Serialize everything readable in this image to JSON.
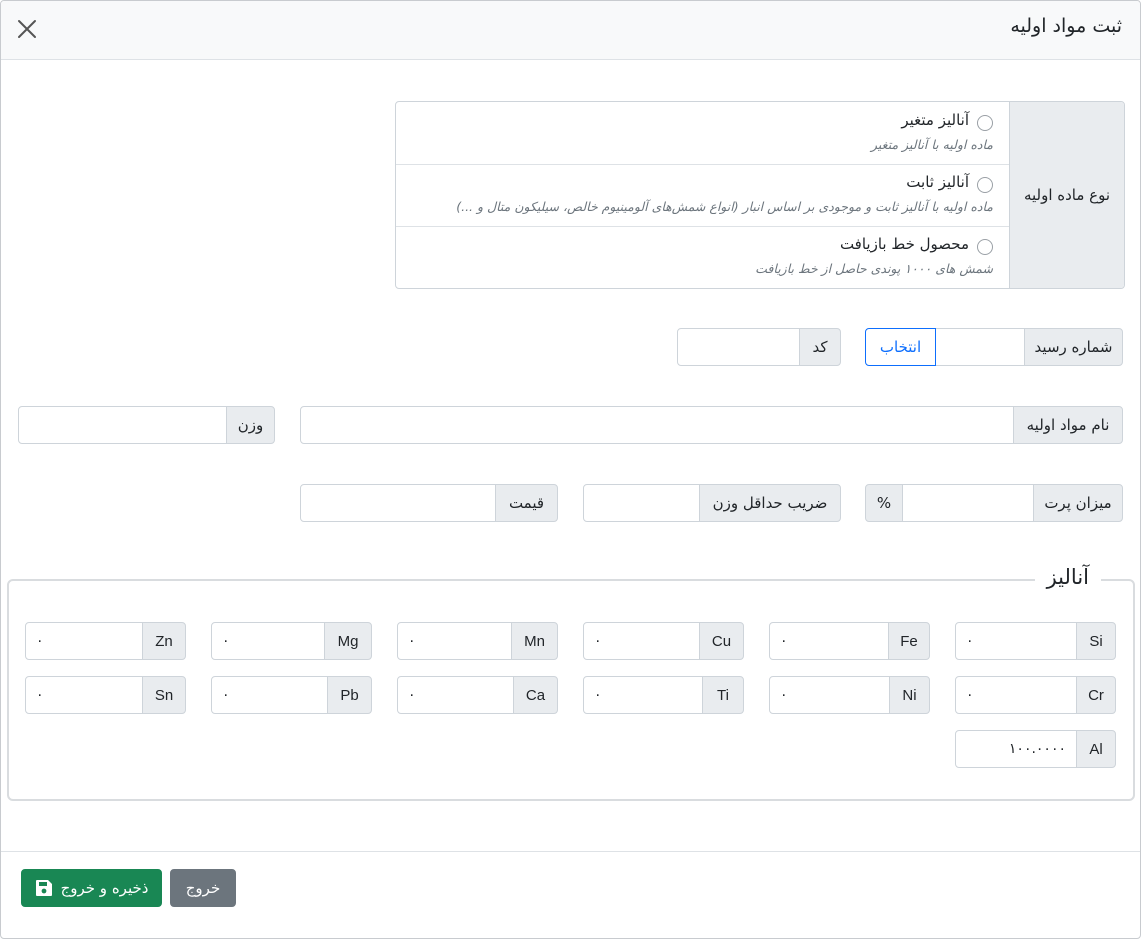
{
  "header": {
    "title": "ثبت مواد اولیه"
  },
  "material_type": {
    "label": "نوع ماده اولیه",
    "options": [
      {
        "title": "آنالیز متغیر",
        "desc": "ماده اولیه با آنالیز متغیر"
      },
      {
        "title": "آنالیز ثابت",
        "desc": "ماده اولیه با آنالیز ثابت و موجودی بر اساس انبار (انواع شمش‌های آلومینیوم خالص، سیلیکون متال و ...)"
      },
      {
        "title": "محصول خط بازیافت",
        "desc": "شمش های ۱۰۰۰ پوندی حاصل از خط بازیافت"
      }
    ]
  },
  "receipt": {
    "label": "شماره رسید",
    "value": "",
    "select_label": "انتخاب"
  },
  "code": {
    "label": "کد",
    "value": ""
  },
  "name": {
    "label": "نام مواد اولیه",
    "value": ""
  },
  "weight": {
    "label": "وزن",
    "value": ""
  },
  "waste": {
    "label": "میزان پرت",
    "unit": "%",
    "value": ""
  },
  "min_weight": {
    "label": "ضریب حداقل وزن",
    "value": ""
  },
  "price": {
    "label": "قیمت",
    "value": ""
  },
  "analysis": {
    "legend": "آنالیز",
    "elements": [
      {
        "symbol": "Si",
        "value": "۰"
      },
      {
        "symbol": "Fe",
        "value": "۰"
      },
      {
        "symbol": "Cu",
        "value": "۰"
      },
      {
        "symbol": "Mn",
        "value": "۰"
      },
      {
        "symbol": "Mg",
        "value": "۰"
      },
      {
        "symbol": "Zn",
        "value": "۰"
      },
      {
        "symbol": "Cr",
        "value": "۰"
      },
      {
        "symbol": "Ni",
        "value": "۰"
      },
      {
        "symbol": "Ti",
        "value": "۰"
      },
      {
        "symbol": "Ca",
        "value": "۰"
      },
      {
        "symbol": "Pb",
        "value": "۰"
      },
      {
        "symbol": "Sn",
        "value": "۰"
      },
      {
        "symbol": "Al",
        "value": "۱۰۰.۰۰۰۰"
      }
    ]
  },
  "footer": {
    "save_exit_label": "ذخیره و خروج",
    "exit_label": "خروج"
  },
  "colors": {
    "success": "#198754",
    "secondary": "#6c757d",
    "primary": "#0d6efd"
  }
}
